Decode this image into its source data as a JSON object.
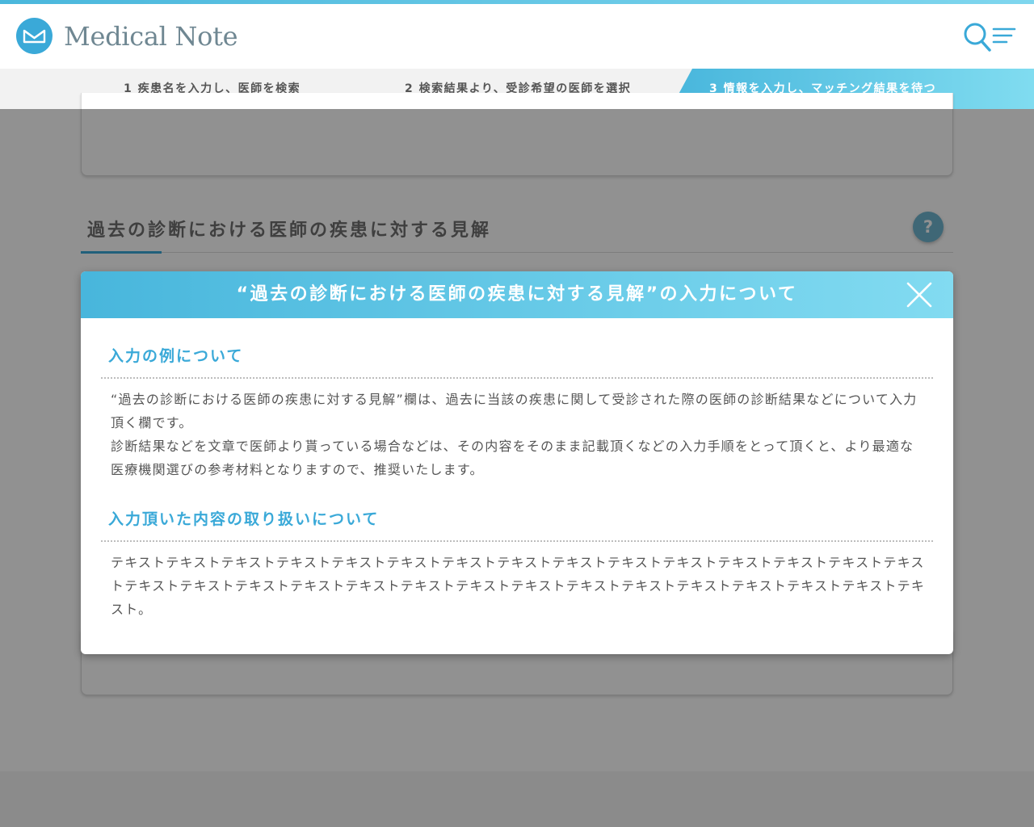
{
  "header": {
    "logo_text": "Medical Note",
    "accent_color": "#3aa9d8",
    "search_icon": "search-icon",
    "menu_icon": "hamburger-menu-icon"
  },
  "steps": [
    {
      "label": "1 疾患名を入力し、医師を検索",
      "active": false
    },
    {
      "label": "2 検索結果より、受診希望の医師を選択",
      "active": false
    },
    {
      "label": "3 情報を入力し、マッチング結果を待つ",
      "active": true
    }
  ],
  "page": {
    "section_title": "過去の診断における医師の疾患に対する見解",
    "help_label": "?"
  },
  "modal": {
    "title": "“過去の診断における医師の疾患に対する見解”の入力について",
    "close_icon": "close-icon",
    "sections": [
      {
        "heading": "入力の例について",
        "paragraphs": [
          "“過去の診断における医師の疾患に対する見解”欄は、過去に当該の疾患に関して受診された際の医師の診断結果などについて入力頂く欄です。",
          "診断結果などを文章で医師より貰っている場合などは、その内容をそのまま記載頂くなどの入力手順をとって頂くと、より最適な医療機関選びの参考材料となりますので、推奨いたします。"
        ]
      },
      {
        "heading": "入力頂いた内容の取り扱いについて",
        "paragraphs": [
          "テキストテキストテキストテキストテキストテキストテキストテキストテキストテキストテキストテキストテキストテキストテキストテキストテキストテキストテキストテキストテキストテキストテキストテキストテキストテキストテキストテキストテキストテキスト。"
        ]
      }
    ]
  }
}
